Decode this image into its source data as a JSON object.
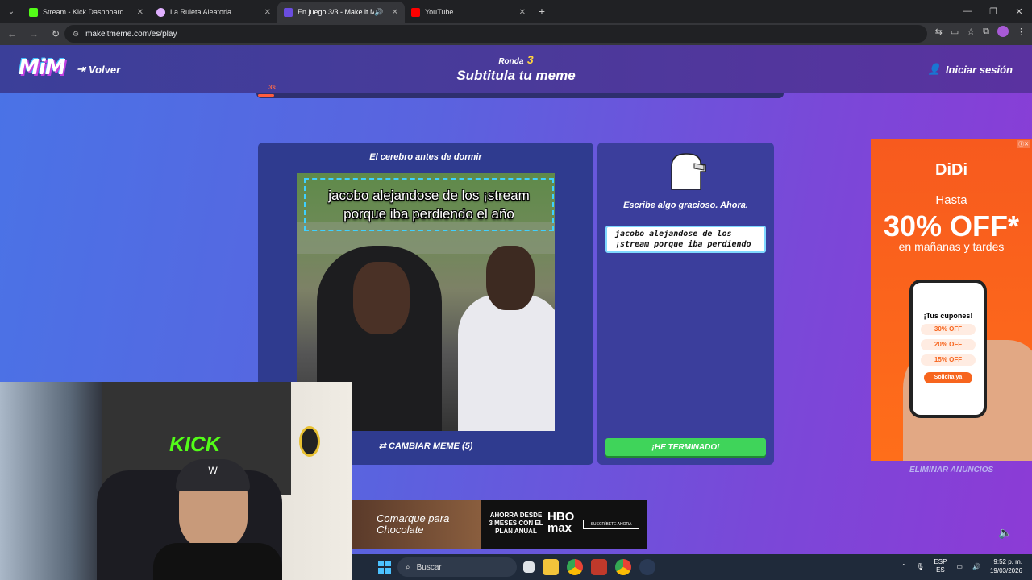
{
  "browser": {
    "tabs": [
      {
        "label": "Stream - Kick Dashboard",
        "favicon_color": "#53fc18"
      },
      {
        "label": "La Ruleta Aleatoria",
        "favicon_color": "#e0b0ff"
      },
      {
        "label": "En juego 3/3 - Make it Meme",
        "favicon_color": "#6a4de0",
        "active": true
      },
      {
        "label": "YouTube",
        "favicon_color": "#ff0000"
      }
    ],
    "url": "makeitmeme.com/es/play"
  },
  "header": {
    "logo": "MiM",
    "back_label": "Volver",
    "round_label": "Ronda",
    "round_number": "3",
    "subtitle": "Subtitula tu meme",
    "login_label": "Iniciar sesión",
    "timer_label": "3s",
    "timer_progress": 0.03
  },
  "meme": {
    "title": "El cerebro antes de dormir",
    "caption_line1": "jacobo alejandose de los ¡stream",
    "caption_line2": "porque iba perdiendo el año",
    "change_label": "CAMBIAR MEME (5)"
  },
  "write": {
    "prompt": "Escribe algo gracioso. Ahora.",
    "input_value": "jacobo alejandose de los ¡stream porque iba perdiendo el año",
    "done_label": "¡HE TERMINADO!"
  },
  "ads": {
    "right": {
      "brand": "DiDi",
      "hasta": "Hasta",
      "percent": "30% OFF*",
      "sub": "en mañanas y tardes",
      "phone_title": "¡Tus cupones!",
      "coupons": [
        "30% OFF",
        "20% OFF",
        "15% OFF"
      ],
      "cta": "Solicita ya"
    },
    "remove_label": "ELIMINAR ANUNCIOS",
    "bottom": {
      "movie": "Comarque para Chocolate",
      "offer": "AHORRA DESDE 3 MESES CON EL PLAN ANUAL",
      "brand": "HBO max",
      "cta": "SUSCRÍBETE AHORA"
    }
  },
  "webcam": {
    "poster_text": "KICK",
    "cap_text": "W"
  },
  "taskbar": {
    "search_placeholder": "Buscar",
    "lang_top": "ESP",
    "lang_bottom": "ES",
    "time": "9:52 p. m.",
    "date": "19/03/2026"
  }
}
